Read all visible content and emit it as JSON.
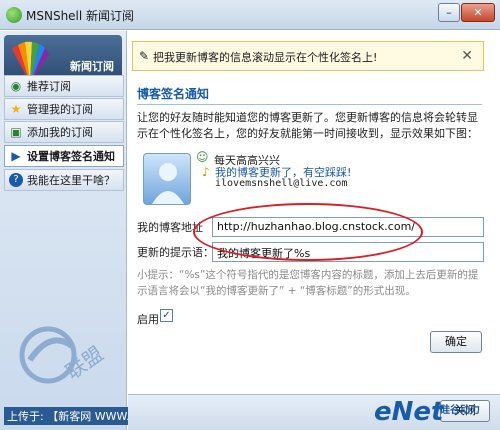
{
  "window": {
    "title": "MSNShell 新闻订阅",
    "minimize_label": "–",
    "close_label": "✕"
  },
  "sidebar": {
    "logo_text": "新闻订阅",
    "items": [
      {
        "label": "推荐订阅",
        "icon": "recommend-icon"
      },
      {
        "label": "管理我的订阅",
        "icon": "star-icon"
      },
      {
        "label": "添加我的订阅",
        "icon": "add-feed-icon"
      },
      {
        "label": "设置博客签名通知",
        "icon": "arrow-icon",
        "active": true
      },
      {
        "label": "我能在这里干啥？",
        "icon": "help-icon"
      }
    ]
  },
  "infobar": {
    "text": "把我更新博客的信息滚动显示在个性化签名上!",
    "close_label": "✕"
  },
  "main": {
    "section_title": "博客签名通知",
    "description": "让您的好友随时能知道您的博客更新了。您更新博客的信息将会轮转显示在个性化签名上，您的好友就能第一时间接收到，显示效果如下图：",
    "preview": {
      "nickname": "每天高高兴兴",
      "blog_notice": "我的博客更新了，有空踩踩!",
      "email": "ilovemsnshell@live.com"
    },
    "blog_url_label": "我的博客地址",
    "blog_url_value": "http://huzhanhao.blog.cnstock.com/",
    "tip_label": "更新的提示语：",
    "tip_value": "我的博客更新了%s",
    "hint": "小提示：“%s”这个符号指代的是您博客内容的标题，添加上去后更新的提示语言将会以“我的博客更新了” + “博客标题”的形式出现。",
    "enable_label": "启用",
    "enable_checked": "✓",
    "ok_label": "确定",
    "close_label": "关闭"
  },
  "footer": {
    "upload_text": "上传于: 【新客网 WWW.XKER.COM】",
    "brand": "eNet",
    "brand_cn": "硅谷动力"
  },
  "colors": {
    "accent": "#1a5ba8",
    "highlight_ellipse": "#d81f26",
    "infobar_bg": "#fffbe3"
  }
}
